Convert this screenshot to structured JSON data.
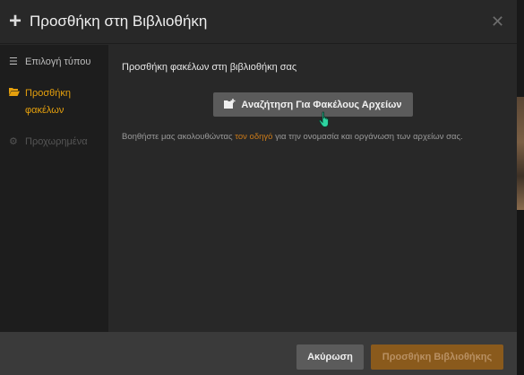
{
  "modal": {
    "title": "Προσθήκη στη Βιβλιοθήκη",
    "plus_icon": "plus-icon",
    "close_icon": "close-icon"
  },
  "sidebar": {
    "items": [
      {
        "label": "Επιλογή τύπου",
        "icon": "list-icon",
        "state": "normal"
      },
      {
        "label": "Προσθήκη φακέλων",
        "icon": "folder-open-icon",
        "state": "active"
      },
      {
        "label": "Προχωρημένα",
        "icon": "gear-icon",
        "state": "disabled"
      }
    ]
  },
  "content": {
    "heading": "Προσθήκη φακέλων στη βιβλιοθήκη σας",
    "browse_button": {
      "label": "Αναζήτηση Για Φακέλους Αρχείων",
      "icon": "folder-plus-icon"
    },
    "help": {
      "before": "Βοηθήστε μας ακολουθώντας ",
      "link": "τον οδηγό",
      "after": " για την ονομασία και οργάνωση των αρχείων σας."
    }
  },
  "footer": {
    "cancel_label": "Ακύρωση",
    "add_label": "Προσθήκη Βιβλιοθήκης"
  },
  "colors": {
    "accent": "#e5a00d",
    "link": "#cc7b19",
    "primary_disabled_bg": "#8a5a1c"
  }
}
